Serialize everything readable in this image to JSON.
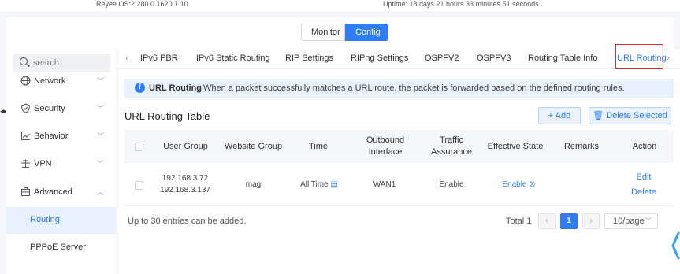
{
  "topbar": {
    "os": "Reyee OS:2.280.0.1620 1.10",
    "uptime": "Uptime: 18 days 21 hours 33 minutes 51 seconds"
  },
  "mode": {
    "monitor": "Monitor",
    "config": "Config"
  },
  "search": {
    "placeholder": "search"
  },
  "sidebar": {
    "items": [
      {
        "label": "Network",
        "icon": "globe-icon"
      },
      {
        "label": "Security",
        "icon": "shield-icon"
      },
      {
        "label": "Behavior",
        "icon": "chart-line-icon"
      },
      {
        "label": "VPN",
        "icon": "vpn-icon"
      },
      {
        "label": "Advanced",
        "icon": "toolbox-icon"
      }
    ],
    "sub_items": [
      "Routing",
      "PPPoE Server"
    ]
  },
  "tabs": [
    "IPv6 PBR",
    "IPv6 Static Routing",
    "RIP Settings",
    "RIPng Settings",
    "OSPFV2",
    "OSPFV3",
    "Routing Table Info",
    "URL Routing"
  ],
  "info": {
    "title": "URL Routing",
    "text": "When a packet successfully matches a URL route, the packet is forwarded based on the defined routing rules."
  },
  "table": {
    "title": "URL Routing Table",
    "add_label": "+ Add",
    "delete_label": "Delete Selected",
    "headers": {
      "user_group": "User Group",
      "website_group": "Website Group",
      "time": "Time",
      "outbound_1": "Outbound",
      "outbound_2": "Interface",
      "traffic_1": "Traffic",
      "traffic_2": "Assurance",
      "effective": "Effective State",
      "remarks": "Remarks",
      "action": "Action"
    },
    "rows": [
      {
        "user_group_1": "192.168.3.72",
        "user_group_2": "192.168.3.137",
        "website_group": "mag",
        "time": "All Time",
        "outbound": "WAN1",
        "traffic": "Enable",
        "effective": "Enable",
        "remarks": "",
        "edit": "Edit",
        "delete": "Delete"
      }
    ]
  },
  "footer": {
    "note": "Up to 30 entries can be added.",
    "total": "Total 1",
    "current_page": "1",
    "page_size": "10/page"
  },
  "colors": {
    "accent": "#2f7cf6",
    "highlight_box": "#d32f2f"
  }
}
